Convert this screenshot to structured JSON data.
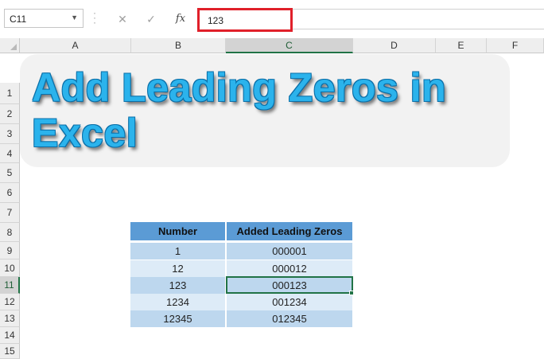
{
  "formula_bar": {
    "name_box": "C11",
    "formula_value": "123",
    "cancel_glyph": "✕",
    "enter_glyph": "✓",
    "fx_glyph": "fx"
  },
  "columns": [
    "A",
    "B",
    "C",
    "D",
    "E",
    "F"
  ],
  "rows": [
    "1",
    "2",
    "3",
    "4",
    "5",
    "6",
    "7",
    "8",
    "9",
    "10",
    "11",
    "12",
    "13",
    "14",
    "15"
  ],
  "active_cell": {
    "column": "C",
    "row": "11"
  },
  "banner": {
    "title": "Add Leading Zeros in Excel"
  },
  "table": {
    "headers": [
      "Number",
      "Added Leading Zeros"
    ],
    "rows": [
      [
        "1",
        "000001"
      ],
      [
        "12",
        "000012"
      ],
      [
        "123",
        "000123"
      ],
      [
        "1234",
        "001234"
      ],
      [
        "12345",
        "012345"
      ]
    ]
  },
  "colors": {
    "highlight_border": "#e0202a",
    "table_header": "#5b9bd5",
    "table_row_dark": "#bdd7ee",
    "table_row_light": "#ddebf7",
    "selection": "#217346",
    "banner_text": "#2bb3ec"
  }
}
